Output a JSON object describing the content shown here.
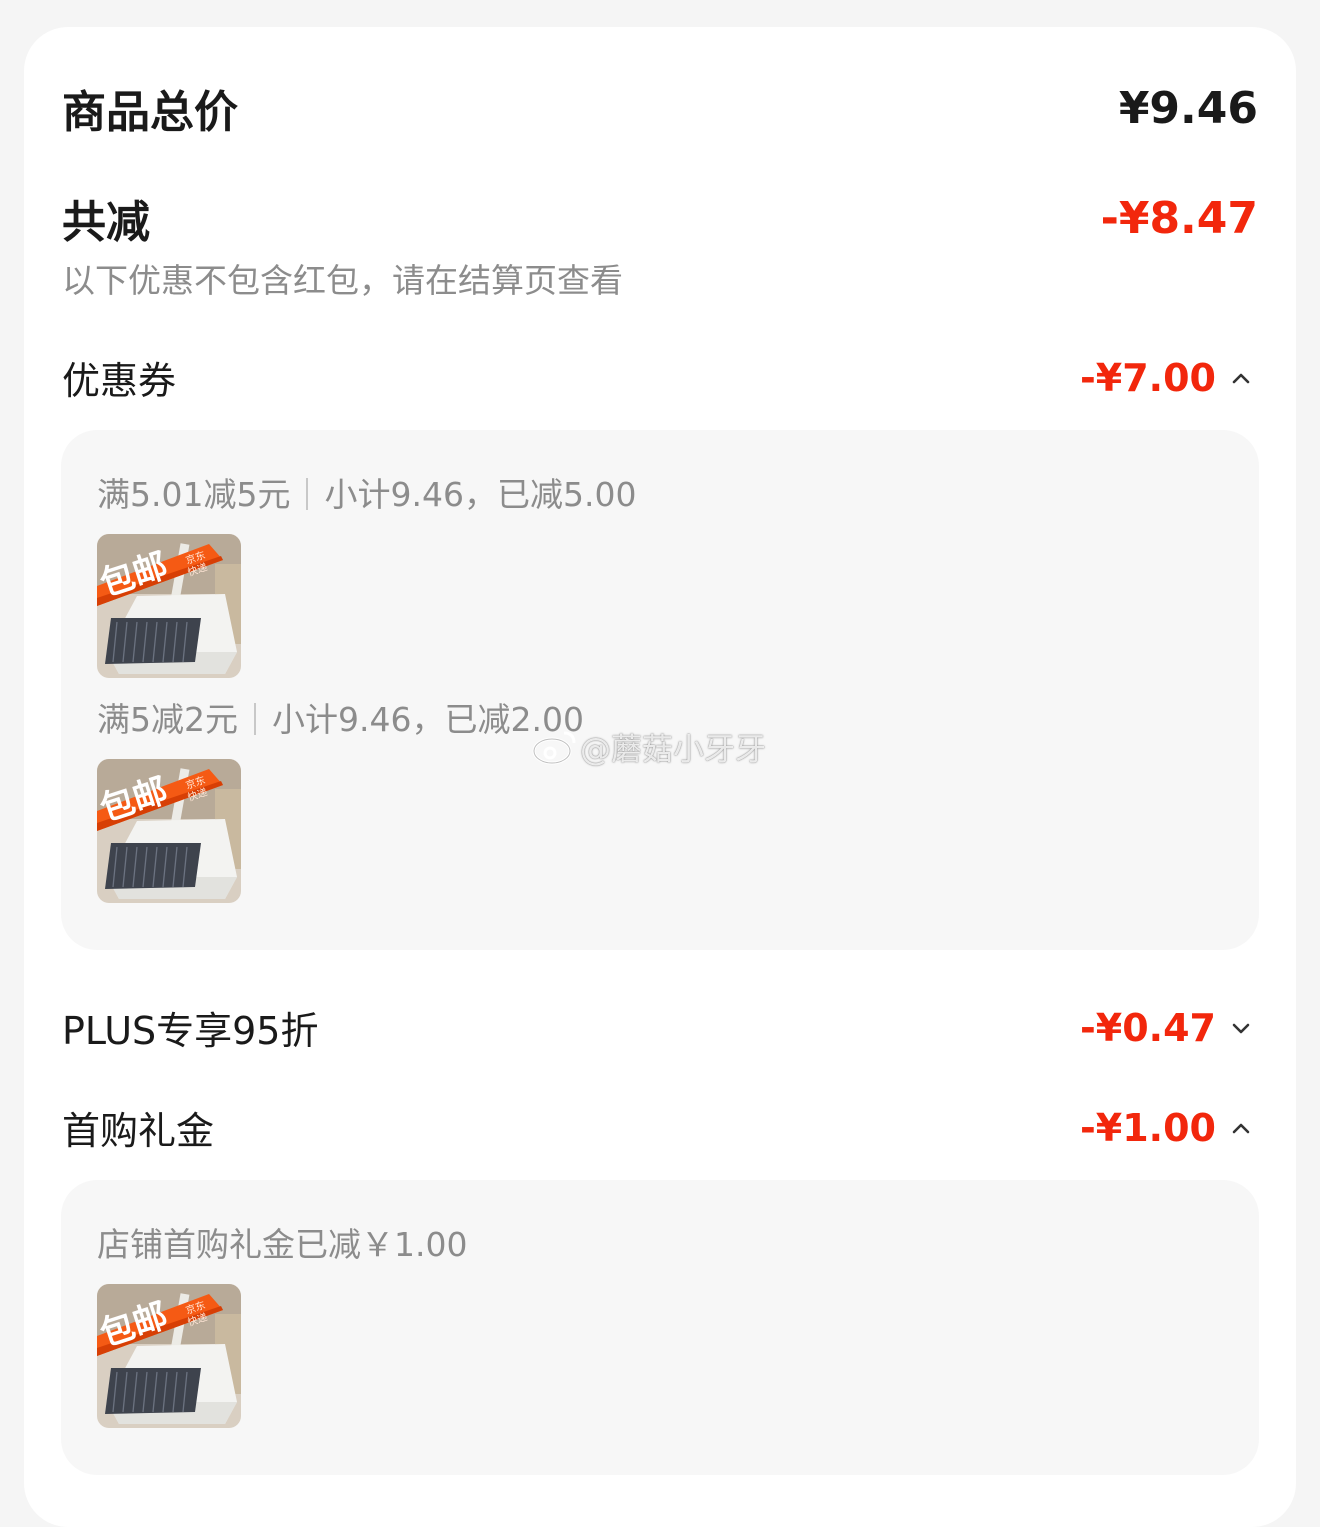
{
  "summary": {
    "total_label": "商品总价",
    "total_value": "¥9.46",
    "saved_label": "共减",
    "saved_value": "-¥8.47",
    "note": "以下优惠不包含红包，请在结算页查看"
  },
  "coupon": {
    "label": "优惠券",
    "value": "-¥7.00",
    "expanded": true,
    "items": [
      {
        "rule": "满5.01减5元",
        "detail": "小计9.46，已减5.00"
      },
      {
        "rule": "满5减2元",
        "detail": "小计9.46，已减2.00"
      }
    ]
  },
  "plus": {
    "label": "PLUS专享95折",
    "value": "-¥0.47",
    "expanded": false
  },
  "first_gift": {
    "label": "首购礼金",
    "value": "-¥1.00",
    "expanded": true,
    "detail": "店铺首购礼金已减￥1.00"
  },
  "product_thumb": {
    "badge_text": "包邮",
    "badge_sub_1": "京东",
    "badge_sub_2": "快递"
  },
  "watermark": "@蘑菇小牙牙",
  "colors": {
    "accent_red": "#f2270c",
    "text_primary": "#1a1a1a",
    "text_secondary": "#8c8c8c",
    "panel_bg": "#f7f7f7"
  },
  "icons": {
    "collapse": "chevron-up-icon",
    "expand": "chevron-down-icon",
    "watermark_logo": "weibo-icon"
  }
}
